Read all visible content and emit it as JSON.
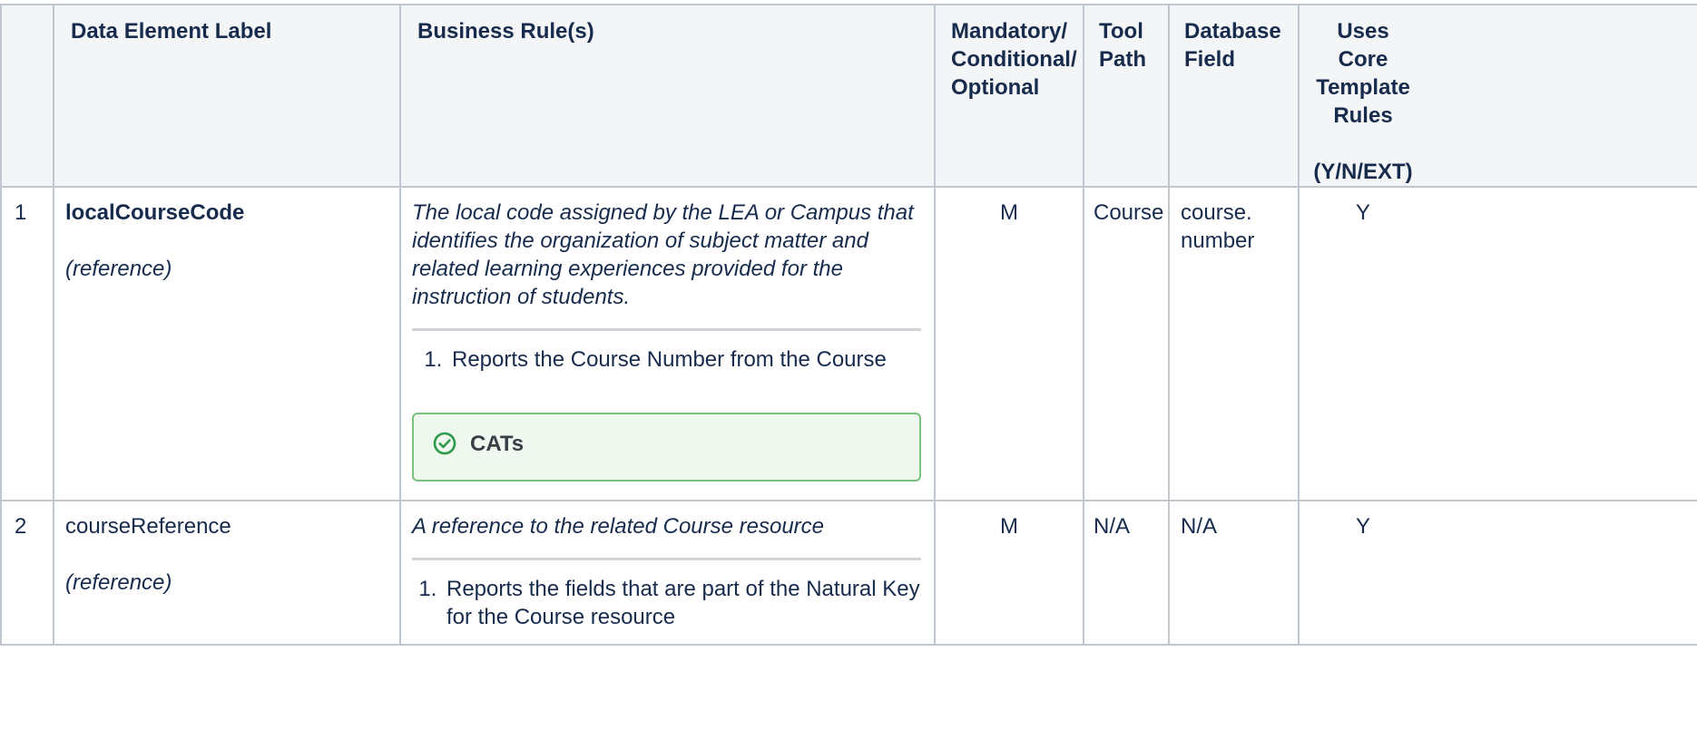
{
  "table": {
    "headers": {
      "num": "",
      "label": "Data Element Label",
      "rules": "Business Rule(s)",
      "mco": "Mandatory/ Conditional/ Optional",
      "tool_path": "Tool Path",
      "db_field": "Database Field",
      "core_rules": "Uses Core Template Rules",
      "core_rules_sub": "(Y/N/EXT)"
    },
    "rows": [
      {
        "num": "1",
        "element": "localCourseCode",
        "element_type": "(reference)",
        "description": "The local code assigned by the LEA or Campus that identifies the organization of subject matter and related learning experiences provided for the instruction of students.",
        "rules": [
          "Reports the Course Number from the Course"
        ],
        "callout": "CATs",
        "mco": "M",
        "tool_path": "Course",
        "db_field": "course. number",
        "core": "Y"
      },
      {
        "num": "2",
        "element": "courseReference",
        "element_type": "(reference)",
        "description": "A reference to the related Course resource",
        "rules": [
          "Reports the fields that are part of the Natural Key for the Course resource"
        ],
        "mco": "M",
        "tool_path": "N/A",
        "db_field": "N/A",
        "core": "Y"
      }
    ]
  },
  "icons": {
    "callout_icon": "check-circle-icon"
  },
  "colors": {
    "header_bg": "#f4f5f7",
    "border": "#c1c7d0",
    "callout_bg": "#eef8ee",
    "callout_border": "#79c27e",
    "callout_icon": "#2e9a49"
  }
}
